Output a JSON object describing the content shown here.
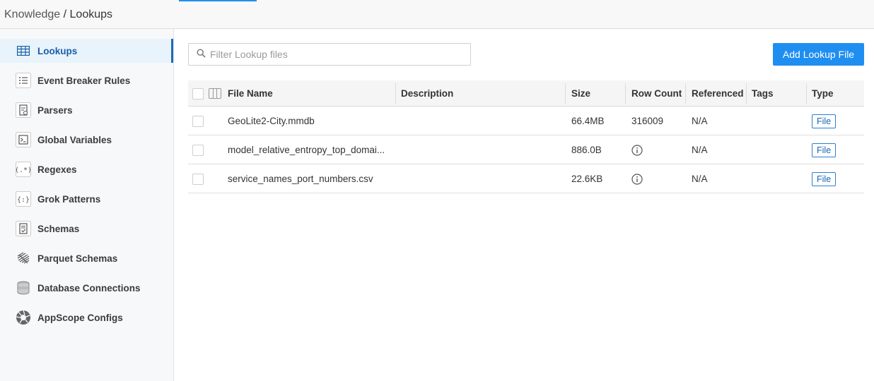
{
  "breadcrumb": {
    "parent": "Knowledge",
    "separator": " / ",
    "current": "Lookups"
  },
  "sidebar": {
    "items": [
      {
        "label": "Lookups",
        "icon": "table-grid-icon",
        "active": true
      },
      {
        "label": "Event Breaker Rules",
        "icon": "list-icon",
        "active": false
      },
      {
        "label": "Parsers",
        "icon": "parser-doc-icon",
        "active": false
      },
      {
        "label": "Global Variables",
        "icon": "terminal-icon",
        "active": false
      },
      {
        "label": "Regexes",
        "icon": "regex-icon",
        "active": false
      },
      {
        "label": "Grok Patterns",
        "icon": "grok-braces-icon",
        "active": false
      },
      {
        "label": "Schemas",
        "icon": "schema-doc-icon",
        "active": false
      },
      {
        "label": "Parquet Schemas",
        "icon": "parquet-icon",
        "active": false
      },
      {
        "label": "Database Connections",
        "icon": "database-icon",
        "active": false
      },
      {
        "label": "AppScope Configs",
        "icon": "appscope-icon",
        "active": false
      }
    ]
  },
  "toolbar": {
    "search_placeholder": "Filter Lookup files",
    "add_label": "Add Lookup File"
  },
  "table": {
    "columns": [
      "File Name",
      "Description",
      "Size",
      "Row Count",
      "Referenced",
      "Tags",
      "Type"
    ],
    "rows": [
      {
        "file_name": "GeoLite2-City.mmdb",
        "description": "",
        "size": "66.4MB",
        "row_count": "316009",
        "referenced": "N/A",
        "tags": "",
        "type": "File"
      },
      {
        "file_name": "model_relative_entropy_top_domai...",
        "description": "",
        "size": "886.0B",
        "row_count": "",
        "referenced": "N/A",
        "tags": "",
        "type": "File"
      },
      {
        "file_name": "service_names_port_numbers.csv",
        "description": "",
        "size": "22.6KB",
        "row_count": "",
        "referenced": "N/A",
        "tags": "",
        "type": "File"
      }
    ]
  },
  "colors": {
    "accent": "#1f8ef1",
    "active_bg": "#e8f3fc",
    "active_text": "#1a5ea6"
  }
}
